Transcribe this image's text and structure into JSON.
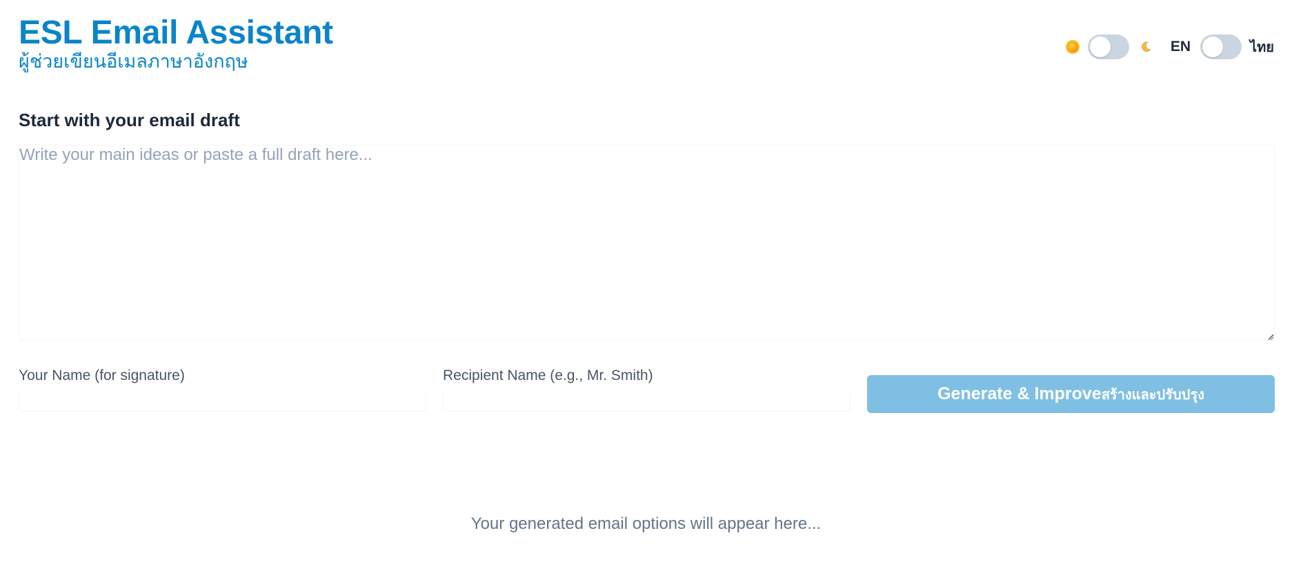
{
  "header": {
    "title": "ESL Email Assistant",
    "subtitle": "ผู้ช่วยเขียนอีเมลภาษาอังกฤษ"
  },
  "controls": {
    "theme_toggle": {
      "left_icon": "sun-icon",
      "right_icon": "moon-icon",
      "checked": false
    },
    "language_toggle": {
      "left_label": "EN",
      "right_label": "ไทย",
      "checked": false
    }
  },
  "draft": {
    "label": "Start with your email draft",
    "placeholder": "Write your main ideas or paste a full draft here...",
    "value": ""
  },
  "fields": {
    "your_name_label": "Your Name (for signature)",
    "your_name_value": "",
    "recipient_label": "Recipient Name (e.g., Mr. Smith)",
    "recipient_value": ""
  },
  "generate_button": {
    "label_en": "Generate & Improve",
    "label_th": "สร้างและปรับปรุง",
    "color": "#7fbfe3"
  },
  "results": {
    "empty_message": "Your generated email options will appear here..."
  },
  "colors": {
    "brand": "#0b84c9",
    "text_dark": "#1e293b",
    "text_muted": "#64748b",
    "toggle_track": "#cbd5e1"
  }
}
